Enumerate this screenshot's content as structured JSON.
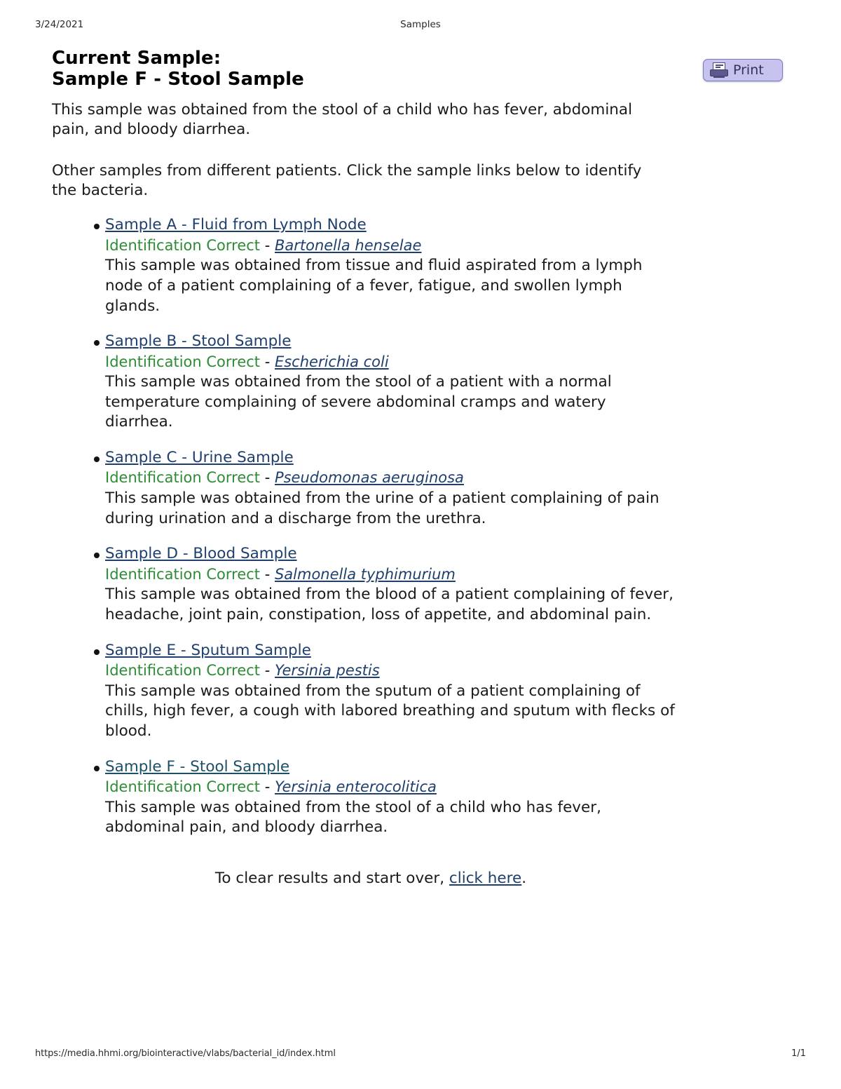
{
  "print_header": {
    "date": "3/24/2021",
    "title": "Samples"
  },
  "print_footer": {
    "url": "https://media.hhmi.org/biointeractive/vlabs/bacterial_id/index.html",
    "page": "1/1"
  },
  "toolbar": {
    "print_label": "Print",
    "print_icon": "printer-icon"
  },
  "header": {
    "title_line1": "Current Sample:",
    "title_line2": "Sample F - Stool Sample"
  },
  "intro": {
    "current_description": "This sample was obtained from the stool of a child who has fever, abdominal pain, and bloody diarrhea.",
    "instructions": "Other samples from different patients. Click the sample links below to identify the bacteria."
  },
  "colors": {
    "link": "#1f3f6e",
    "link_alt": "#1c5068",
    "correct": "#2e8b36",
    "print_button_bg": "#c6c4ee",
    "print_button_border": "#7d7ac0",
    "text": "#1a1a1a"
  },
  "samples": [
    {
      "link": "Sample A - Fluid from Lymph Node ",
      "status": "Identification Correct",
      "dash": " - ",
      "species": "Bartonella henselae",
      "description": "This sample was obtained from tissue and fluid aspirated from a lymph node of a patient complaining of a fever, fatigue, and swollen lymph glands."
    },
    {
      "link": "Sample B - Stool Sample ",
      "status": "Identification Correct",
      "dash": " - ",
      "species": "Escherichia coli",
      "description": "This sample was obtained from the stool of a patient with a normal temperature complaining of severe abdominal cramps and watery diarrhea."
    },
    {
      "link": "Sample C - Urine Sample ",
      "status": "Identification Correct",
      "dash": " - ",
      "species": "Pseudomonas aeruginosa",
      "description": "This sample was obtained from the urine of a patient complaining of pain during urination and a discharge from the urethra."
    },
    {
      "link": "Sample D - Blood Sample ",
      "status": "Identification Correct",
      "dash": " - ",
      "species": "Salmonella typhimurium",
      "description": "This sample was obtained from the blood of a patient complaining of fever, headache, joint pain, constipation, loss of appetite, and abdominal pain."
    },
    {
      "link": "Sample E - Sputum Sample ",
      "status": "Identification Correct",
      "dash": " - ",
      "species": "Yersinia pestis",
      "description": "This sample was obtained from the sputum of a patient complaining of chills, high fever, a cough with labored breathing and sputum with flecks of blood."
    },
    {
      "link": "Sample F - Stool Sample ",
      "status": "Identification Correct",
      "dash": " - ",
      "species": "Yersinia enterocolitica",
      "description": "This sample was obtained from the stool of a child who has fever, abdominal pain, and bloody diarrhea."
    }
  ],
  "closing": {
    "prefix": "To clear results and start over, ",
    "link": "click here",
    "suffix": "."
  }
}
